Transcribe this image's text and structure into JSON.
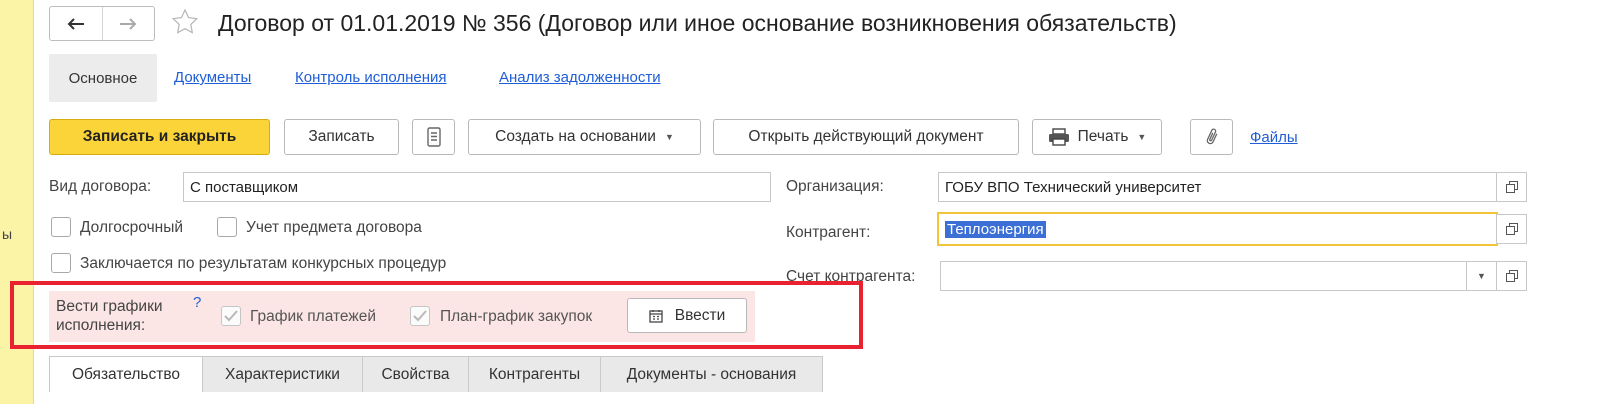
{
  "left_strip": {
    "text": "ы"
  },
  "header": {
    "title": "Договор от 01.01.2019 № 356 (Договор или иное основание возникновения обязательств)",
    "back_icon": "arrow-left-icon",
    "forward_icon": "arrow-right-icon",
    "favorite_icon": "star-outline-icon"
  },
  "nav_tabs": {
    "active": "Основное",
    "links": [
      "Документы",
      "Контроль исполнения",
      "Анализ задолженности"
    ]
  },
  "toolbar": {
    "save_close": "Записать и закрыть",
    "save": "Записать",
    "list_icon": "list-icon",
    "create_based": "Создать на основании",
    "open_current": "Открыть действующий документ",
    "print": "Печать",
    "print_icon": "printer-icon",
    "attach_icon": "paperclip-icon",
    "files": "Файлы"
  },
  "form": {
    "contract_type_label": "Вид договора:",
    "contract_type_value": "С поставщиком",
    "long_term_label": "Долгосрочный",
    "subject_accounting_label": "Учет предмета договора",
    "tender_label": "Заключается по результатам конкурсных процедур",
    "organization_label": "Организация:",
    "organization_value": "ГОБУ ВПО Технический университет",
    "counterparty_label": "Контрагент:",
    "counterparty_value": "Теплоэнергия",
    "counterparty_account_label": "Счет контрагента:",
    "counterparty_account_value": ""
  },
  "schedules": {
    "label_line1": "Вести графики",
    "label_line2": "исполнения:",
    "help": "?",
    "payment_schedule": "График платежей",
    "payment_schedule_checked": true,
    "purchase_schedule": "План-график закупок",
    "purchase_schedule_checked": true,
    "enter_button": "Ввести",
    "calendar_icon": "calendar-icon"
  },
  "bottom_tabs": [
    "Обязательство",
    "Характеристики",
    "Свойства",
    "Контрагенты",
    "Документы - основания"
  ],
  "colors": {
    "primary_button": "#fbd43a",
    "link": "#1f5ed6",
    "highlight_frame": "#e8232f",
    "panel_bg": "#fbe5e5",
    "focus_border": "#f3c33a"
  }
}
